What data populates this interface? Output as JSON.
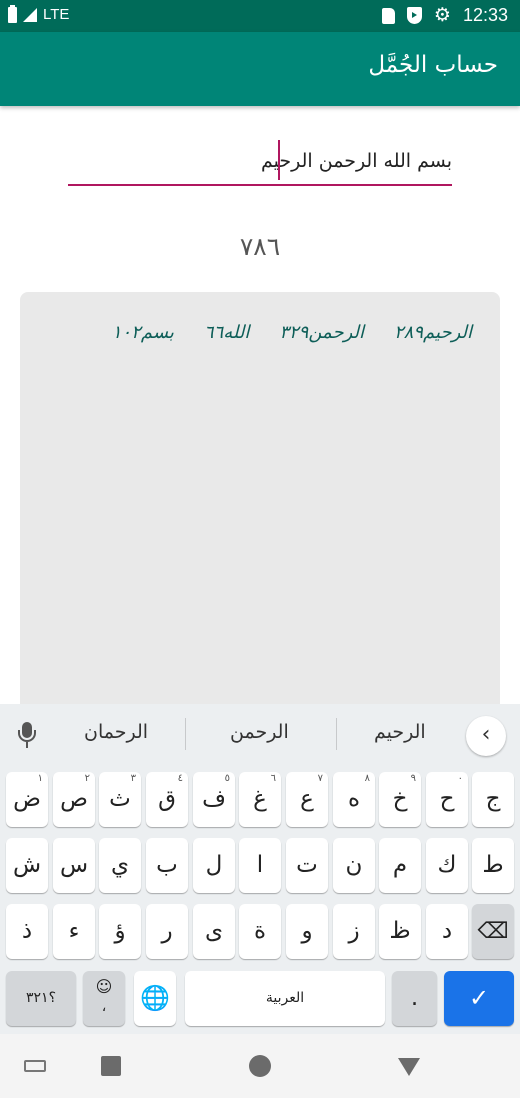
{
  "status_bar": {
    "network": "LTE",
    "time": "12:33",
    "icons": [
      "battery-icon",
      "signal-icon",
      "sdcard-icon",
      "shield-icon",
      "gear-icon"
    ]
  },
  "app": {
    "title": "حساب الجُمَّل",
    "colors": {
      "status_bar": "#006b59",
      "app_bar": "#008577",
      "accent": "#b0175f",
      "breakdown_text": "#0e5e58"
    }
  },
  "input": {
    "value": "بسم الله الرحمن الرحيم"
  },
  "result": {
    "total": "٧٨٦"
  },
  "breakdown": [
    {
      "text": "بسم١٠٢"
    },
    {
      "text": "الله٦٦"
    },
    {
      "text": "الرحمن٣٢٩"
    },
    {
      "text": "الرحيم٢٨٩"
    }
  ],
  "keyboard": {
    "suggestions": [
      "الرحيم",
      "الرحمن",
      "الرحمان"
    ],
    "collapse_icon": "chevron-left-icon",
    "row1": [
      {
        "label": "ض",
        "sup": "١"
      },
      {
        "label": "ص",
        "sup": "٢"
      },
      {
        "label": "ث",
        "sup": "٣"
      },
      {
        "label": "ق",
        "sup": "٤"
      },
      {
        "label": "ف",
        "sup": "٥"
      },
      {
        "label": "غ",
        "sup": "٦"
      },
      {
        "label": "ع",
        "sup": "٧"
      },
      {
        "label": "ه",
        "sup": "٨"
      },
      {
        "label": "خ",
        "sup": "٩"
      },
      {
        "label": "ح",
        "sup": "٠"
      },
      {
        "label": "ج",
        "sup": ""
      }
    ],
    "row2": [
      "ش",
      "س",
      "ي",
      "ب",
      "ل",
      "ا",
      "ت",
      "ن",
      "م",
      "ك",
      "ط"
    ],
    "row3": [
      "ذ",
      "ء",
      "ؤ",
      "ر",
      "ى",
      "ة",
      "و",
      "ز",
      "ظ",
      "د"
    ],
    "backspace_icon": "backspace-icon",
    "symbols_label": "؟٣٢١",
    "emoji_sub": "،",
    "globe_icon": "globe-icon",
    "space_label": "العربية",
    "period_label": ".",
    "enter_icon": "check-icon"
  },
  "nav_bar": {
    "icons": [
      "keyboard-icon",
      "recents-icon",
      "home-icon",
      "back-icon"
    ]
  }
}
